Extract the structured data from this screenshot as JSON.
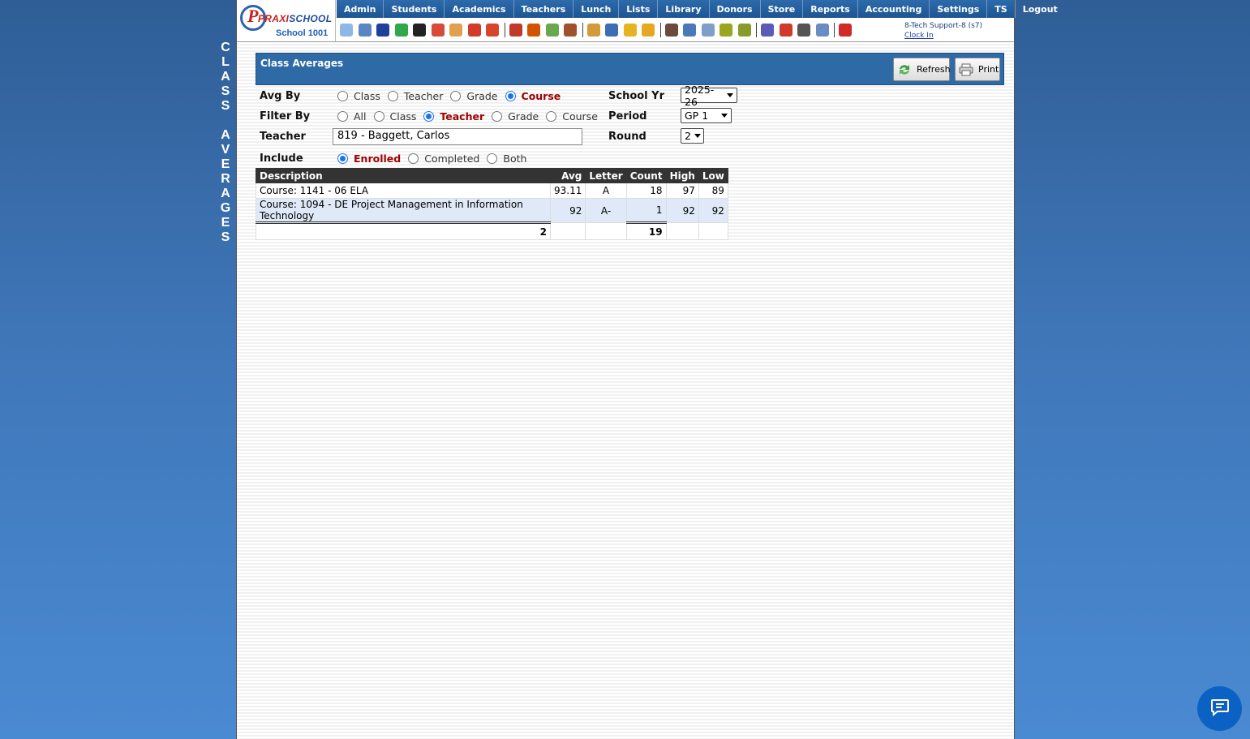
{
  "side_title": [
    "C",
    "L",
    "A",
    "S",
    "S",
    "",
    "A",
    "V",
    "E",
    "R",
    "A",
    "G",
    "E",
    "S"
  ],
  "logo": {
    "name_a": "PRAXI",
    "name_b": "SCHOOL",
    "school": "School 1001"
  },
  "menu": [
    "Admin",
    "Students",
    "Academics",
    "Teachers",
    "Lunch",
    "Lists",
    "Library",
    "Donors",
    "Store",
    "Reports",
    "Accounting",
    "Settings",
    "TS",
    "Logout"
  ],
  "toolbar_icons": [
    {
      "name": "search-icon",
      "color": "#8fb7e6"
    },
    {
      "name": "calendar-grid-icon",
      "color": "#5b86c4"
    },
    {
      "name": "email-at-icon",
      "color": "#1f3f9a"
    },
    {
      "name": "chat-icon",
      "color": "#2ea84a"
    },
    {
      "name": "mobile-phone-icon",
      "color": "#222222"
    },
    {
      "name": "flag-icon",
      "color": "#d84a3a"
    },
    {
      "name": "report-icon",
      "color": "#e0a050"
    },
    {
      "name": "calendar-icon",
      "color": "#d23a2a"
    },
    {
      "name": "megaphone-icon",
      "color": "#d6452c"
    },
    {
      "name": "student-red-icon",
      "color": "#c0392b"
    },
    {
      "name": "student-orange-icon",
      "color": "#d35400"
    },
    {
      "name": "money-icon",
      "color": "#6aa84f"
    },
    {
      "name": "people-icon",
      "color": "#a0522d"
    },
    {
      "name": "lunch-icon",
      "color": "#d49a3a"
    },
    {
      "name": "book-icon",
      "color": "#3b6eb5"
    },
    {
      "name": "bell-icon",
      "color": "#e6b422"
    },
    {
      "name": "arrow-right-icon",
      "color": "#e6a823"
    },
    {
      "name": "teacher-icon",
      "color": "#6b4c3b"
    },
    {
      "name": "clock-icon",
      "color": "#4a78b8"
    },
    {
      "name": "list-icon",
      "color": "#7f9fc9"
    },
    {
      "name": "card-icon",
      "color": "#9aa520"
    },
    {
      "name": "printer-icon",
      "color": "#8a9a2a"
    },
    {
      "name": "ap-icon",
      "color": "#5a5ab8"
    },
    {
      "name": "pdf-icon",
      "color": "#d03a2a"
    },
    {
      "name": "cash-register-icon",
      "color": "#555555"
    },
    {
      "name": "help-icon",
      "color": "#6a8cc4"
    },
    {
      "name": "power-icon",
      "color": "#d02a2a"
    }
  ],
  "user": {
    "name": "8-Tech Support-8 (s7)",
    "clock_link": "Clock In"
  },
  "panel": {
    "title": "Class Averages",
    "refresh": "Refresh",
    "print": "Print"
  },
  "form": {
    "avg_by": {
      "label": "Avg By",
      "options": [
        "Class",
        "Teacher",
        "Grade",
        "Course"
      ]
    },
    "filter_by": {
      "label": "Filter By",
      "options": [
        "All",
        "Class",
        "Teacher",
        "Grade",
        "Course"
      ]
    },
    "teacher": {
      "label": "Teacher",
      "value": "819 - Baggett, Carlos"
    },
    "include": {
      "label": "Include",
      "options": [
        "Enrolled",
        "Completed",
        "Both"
      ]
    },
    "school_yr": {
      "label": "School Yr",
      "value": "2025-26"
    },
    "period": {
      "label": "Period",
      "value": "GP 1"
    },
    "round": {
      "label": "Round",
      "value": "2"
    }
  },
  "table": {
    "headers": [
      "Description",
      "Avg",
      "Letter",
      "Count",
      "High",
      "Low"
    ],
    "rows": [
      {
        "description": "Course: 1141 - 06 ELA",
        "avg": "93.11",
        "letter": "A",
        "count": "18",
        "high": "97",
        "low": "89"
      },
      {
        "description": "Course: 1094 - DE Project Management in Information Technology",
        "avg": "92",
        "letter": "A-",
        "count": "1",
        "high": "92",
        "low": "92"
      }
    ],
    "totals": {
      "description": "2",
      "count": "19"
    }
  }
}
